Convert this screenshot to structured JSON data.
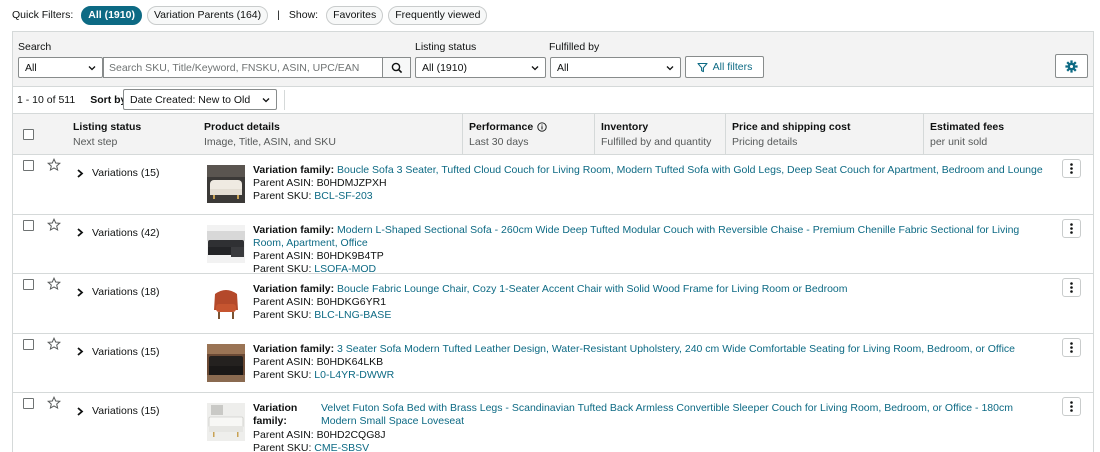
{
  "quick_filters": {
    "label": "Quick Filters:",
    "all": "All (1910)",
    "variation_parents": "Variation Parents (164)",
    "separator": "|",
    "show_label": "Show:",
    "favorites": "Favorites",
    "frequently_viewed": "Frequently viewed"
  },
  "search": {
    "label": "Search",
    "scope_value": "All",
    "placeholder": "Search SKU, Title/Keyword, FNSKU, ASIN, UPC/EAN"
  },
  "listing_status": {
    "label": "Listing status",
    "value": "All (1910)"
  },
  "fulfilled_by": {
    "label": "Fulfilled by",
    "value": "All"
  },
  "all_filters_label": "All filters",
  "pagination": {
    "range": "1 - 10 of 511"
  },
  "sort": {
    "label": "Sort by:",
    "value": "Date Created: New to Old"
  },
  "columns": [
    {
      "title": "Listing status",
      "subtitle": "Next step"
    },
    {
      "title": "Product details",
      "subtitle": "Image, Title, ASIN, and SKU"
    },
    {
      "title": "Performance",
      "subtitle": "Last 30 days"
    },
    {
      "title": "Inventory",
      "subtitle": "Fulfilled by and quantity"
    },
    {
      "title": "Price and shipping cost",
      "subtitle": "Pricing details"
    },
    {
      "title": "Estimated fees",
      "subtitle": "per unit sold"
    }
  ],
  "labels": {
    "variation_family": "Variation family:",
    "variation_family_line1": "Variation",
    "variation_family_line2": "family:",
    "parent_asin": "Parent ASIN:",
    "parent_sku": "Parent SKU:"
  },
  "rows": [
    {
      "variations": "Variations (15)",
      "title": "Boucle Sofa 3 Seater, Tufted Cloud Couch for Living Room, Modern Tufted Sofa with Gold Legs, Deep Seat Couch for Apartment, Bedroom and Lounge",
      "asin": "B0HDMJZPXH",
      "sku": "BCL-SF-203"
    },
    {
      "variations": "Variations (42)",
      "title": "Modern L-Shaped Sectional Sofa - 260cm Wide Deep Tufted Modular Couch with Reversible Chaise - Premium Chenille Fabric Sectional for Living Room, Apartment, Office",
      "asin": "B0HDK9B4TP",
      "sku": "LSOFA-MOD"
    },
    {
      "variations": "Variations (18)",
      "title": "Boucle Fabric Lounge Chair, Cozy 1-Seater Accent Chair with Solid Wood Frame for Living Room or Bedroom",
      "asin": "B0HDKG6YR1",
      "sku": "BLC-LNG-BASE"
    },
    {
      "variations": "Variations (15)",
      "title": "3 Seater Sofa Modern Tufted Leather Design, Water-Resistant Upholstery, 240 cm Wide Comfortable Seating for Living Room, Bedroom, or Office",
      "asin": "B0HDK64LKB",
      "sku": "L0-L4YR-DWWR"
    },
    {
      "variations": "Variations (15)",
      "title": "Velvet Futon Sofa Bed with Brass Legs - Scandinavian Tufted Back Armless Convertible Sleeper Couch for Living Room, Bedroom, or Office - 180cm Modern Small Space Loveseat",
      "asin": "B0HD2CQG8J",
      "sku": "CME-SBSV"
    }
  ],
  "colors": {
    "accent": "#0d6a84",
    "border": "#d5d9d9",
    "panel_bg": "#f3f3f3"
  }
}
